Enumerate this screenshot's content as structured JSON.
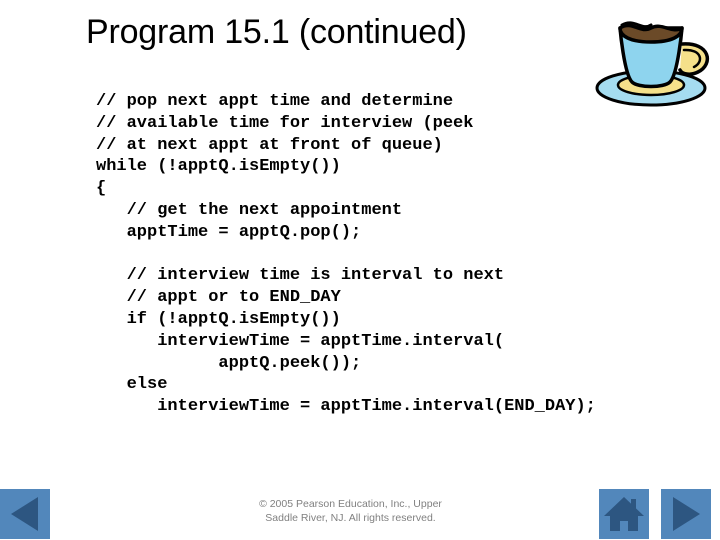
{
  "slide": {
    "title": "Program 15.1 (continued)"
  },
  "code": {
    "language": "java",
    "lines": [
      "// pop next appt time and determine",
      "// available time for interview (peek",
      "// at next appt at front of queue)",
      "while (!apptQ.isEmpty())",
      "{",
      "   // get the next appointment",
      "   apptTime = apptQ.pop();",
      "",
      "   // interview time is interval to next",
      "   // appt or to END_DAY",
      "   if (!apptQ.isEmpty())",
      "      interviewTime = apptTime.interval(",
      "            apptQ.peek());",
      "   else",
      "      interviewTime = apptTime.interval(END_DAY);"
    ]
  },
  "footer": {
    "copyright_line1": "© 2005 Pearson Education, Inc., Upper",
    "copyright_line2": "Saddle River, NJ.  All rights reserved."
  },
  "navigation": {
    "back_label": "previous-slide",
    "home_label": "home",
    "forward_label": "next-slide"
  },
  "decor": {
    "coffee_cup_label": "coffee-cup"
  },
  "colors": {
    "nav_button_bg": "#5287bb",
    "nav_glyph": "#2d5681",
    "title_text": "#000000",
    "code_text": "#000000",
    "footer_text": "#808080",
    "cup_body": "#8ed4ee",
    "cup_accent": "#f5e08a",
    "coffee": "#6b4a28",
    "saucer": "#a5dcf0"
  }
}
